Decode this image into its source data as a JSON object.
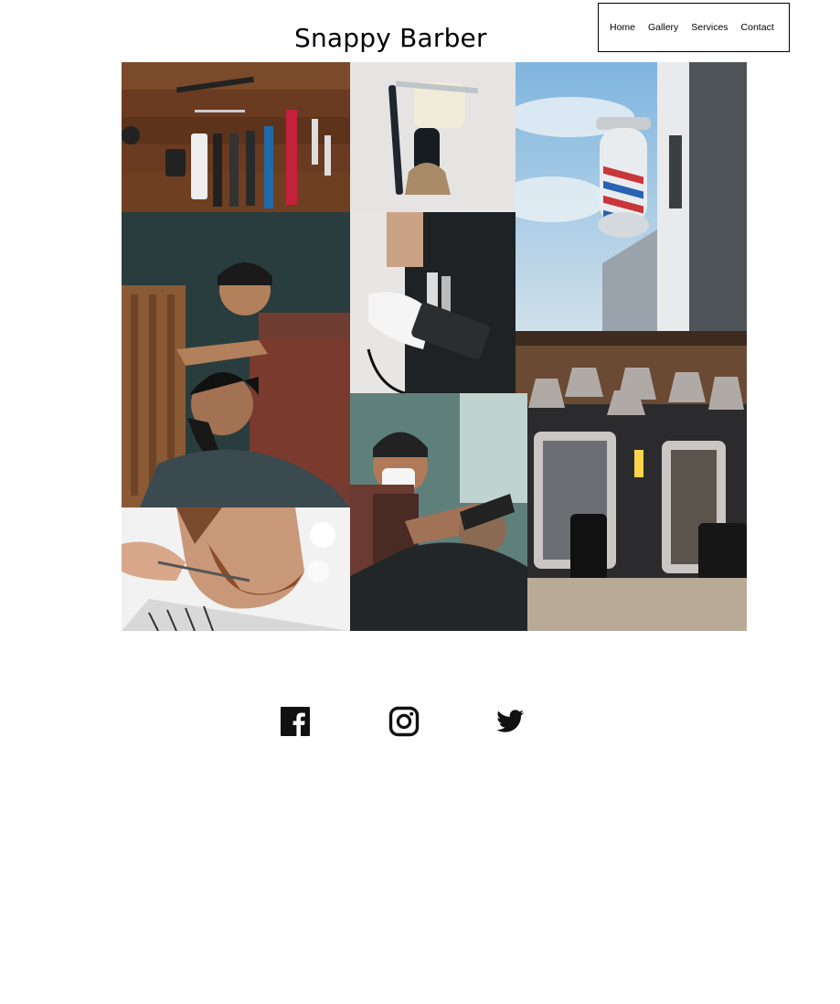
{
  "site": {
    "title": "Snappy Barber"
  },
  "nav": {
    "items": [
      {
        "label": "Home"
      },
      {
        "label": "Gallery"
      },
      {
        "label": "Services"
      },
      {
        "label": "Contact"
      }
    ]
  },
  "gallery": {
    "images": [
      {
        "name": "barber-tools-flatlay"
      },
      {
        "name": "straight-razor-and-brush"
      },
      {
        "name": "barber-pole"
      },
      {
        "name": "barber-styling-beard"
      },
      {
        "name": "barber-apron-tools"
      },
      {
        "name": "barber-shop-interior"
      },
      {
        "name": "beard-trim-scissors"
      },
      {
        "name": "masked-barber-shave"
      }
    ]
  },
  "social": {
    "icons": [
      "facebook-icon",
      "instagram-icon",
      "twitter-icon"
    ]
  },
  "colors": {
    "background": "#ffffff",
    "text": "#000000",
    "pole_red": "#c8353a",
    "pole_blue": "#2a62b3"
  }
}
